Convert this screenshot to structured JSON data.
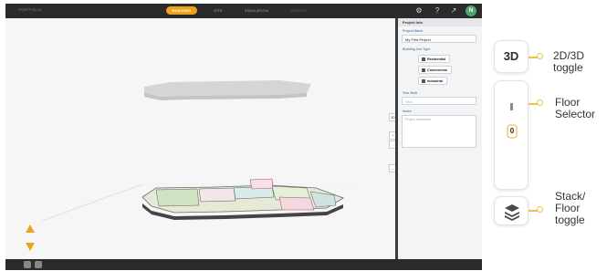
{
  "app": {
    "project_label": "PORTFOLIO",
    "tabs": [
      {
        "label": "BUILDING",
        "active": true
      },
      {
        "label": "SITE",
        "active": false
      },
      {
        "label": "SIMULATION",
        "active": false
      },
      {
        "label": "REPORT",
        "active": false
      }
    ],
    "avatar_letter": "N",
    "accent_color": "#f0a21b"
  },
  "panel": {
    "title": "Project Info",
    "project_name_label": "Project Name",
    "project_name_value": "My First Project",
    "building_type_label": "Building Use Type",
    "types": [
      "Residential",
      "Commercial",
      "Industrial"
    ],
    "year_label": "Year Built",
    "year_placeholder": "Year",
    "notes_label": "Notes",
    "notes_placeholder": "Project comments"
  },
  "viewport_tools": [
    "3D",
    "+",
    "-",
    "←"
  ],
  "callouts": {
    "toggle_3d_text": "3D",
    "toggle_3d_label": [
      "2D/3D",
      "toggle"
    ],
    "floor_selector_label": [
      "Floor",
      "Selector"
    ],
    "floor_selector_value": "0",
    "stack_label": [
      "Stack/",
      "Floor",
      "toggle"
    ]
  }
}
